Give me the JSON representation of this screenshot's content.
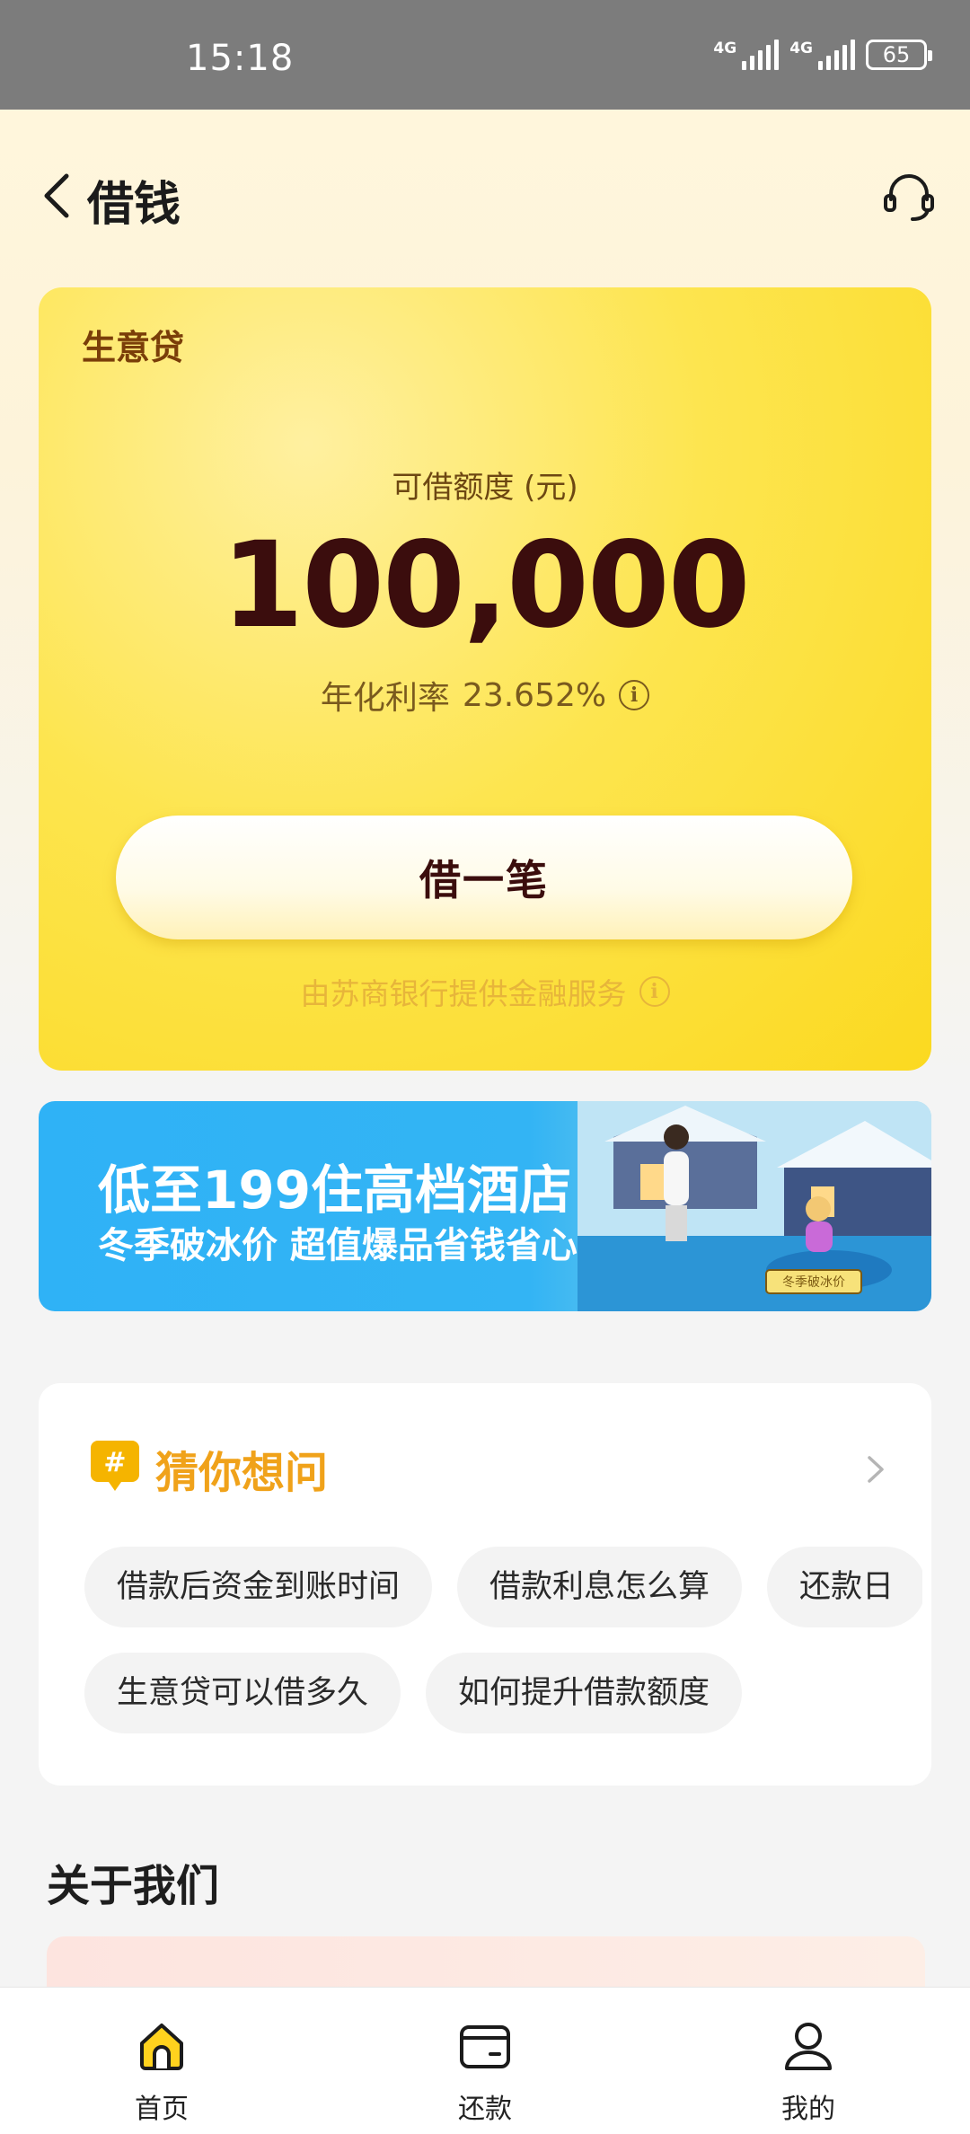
{
  "status_bar": {
    "time": "15:18",
    "network_1": "4G",
    "network_2": "4G",
    "battery": "65"
  },
  "nav": {
    "title": "借钱",
    "back_icon": "chevron-left-icon",
    "service_icon": "headset-icon"
  },
  "loan_card": {
    "product": "生意贷",
    "amount_label": "可借额度 (元)",
    "amount": "100,000",
    "rate_label": "年化利率",
    "rate_value": "23.652%",
    "borrow_button": "借一笔",
    "provider": "由苏商银行提供金融服务",
    "colors": {
      "card": "#fde54f",
      "amount": "#3b0d0d",
      "provider": "#e7b53a"
    }
  },
  "banner": {
    "line1": "低至199住高档酒店",
    "line2": "冬季破冰价 超值爆品省钱省心",
    "tag": "冬季破冰价"
  },
  "faq": {
    "title": "猜你想问",
    "icon_glyph": "#",
    "row1": [
      "借款后资金到账时间",
      "借款利息怎么算",
      "还款日"
    ],
    "row2": [
      "生意贷可以借多久",
      "如何提升借款额度"
    ]
  },
  "about": {
    "title": "关于我们"
  },
  "tabs": [
    {
      "label": "首页",
      "icon": "home-icon",
      "active": true
    },
    {
      "label": "还款",
      "icon": "wallet-icon",
      "active": false
    },
    {
      "label": "我的",
      "icon": "user-icon",
      "active": false
    }
  ]
}
